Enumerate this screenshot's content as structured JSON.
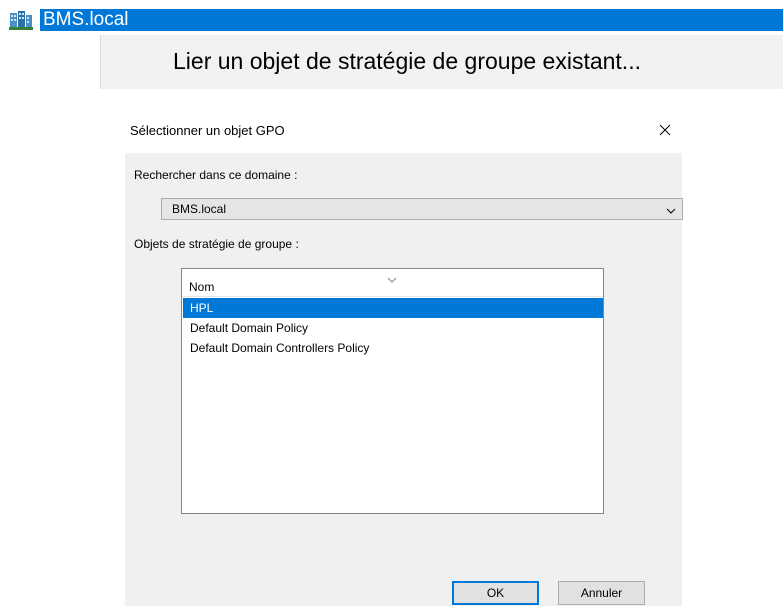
{
  "tree": {
    "selected_node": "BMS.local",
    "node_icon": "domain-icon"
  },
  "context_menu": {
    "item_label": "Lier un objet de stratégie de groupe existant..."
  },
  "dialog": {
    "title": "Sélectionner un objet GPO",
    "close_icon": "close-icon",
    "search_domain_label": "Rechercher dans ce domaine :",
    "domain_select": {
      "selected_value": "BMS.local"
    },
    "gpo_list_label": "Objets de stratégie de groupe :",
    "gpo_list": {
      "column_header": "Nom",
      "items": [
        {
          "name": "HPL",
          "selected": true
        },
        {
          "name": "Default Domain Policy",
          "selected": false
        },
        {
          "name": "Default Domain Controllers Policy",
          "selected": false
        }
      ]
    },
    "ok_button": "OK",
    "cancel_button": "Annuler"
  },
  "colors": {
    "selection": "#0078d7",
    "dialog_body": "#f0f0f0"
  }
}
